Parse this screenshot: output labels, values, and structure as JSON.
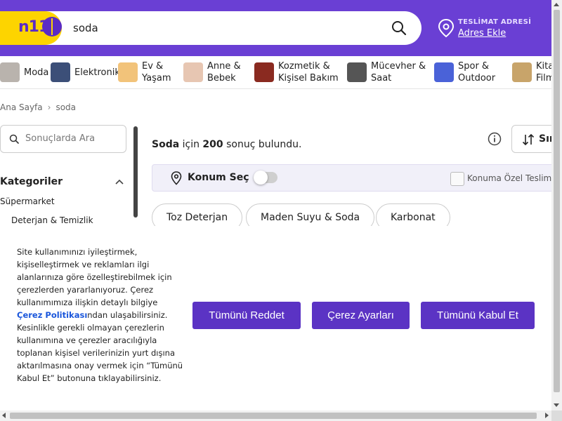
{
  "header": {
    "logo_text": "n11",
    "search_value": "soda",
    "address_label": "TESLİMAT ADRESİ",
    "address_link": "Adres Ekle"
  },
  "categories": [
    {
      "label": "Moda",
      "color": "#b9b3ad"
    },
    {
      "label": "Elektronik",
      "color": "#3c4f78"
    },
    {
      "label": "Ev &\nYaşam",
      "color": "#f2c37a"
    },
    {
      "label": "Anne &\nBebek",
      "color": "#e7c6b2"
    },
    {
      "label": "Kozmetik &\nKişisel Bakım",
      "color": "#8a2a20"
    },
    {
      "label": "Mücevher &\nSaat",
      "color": "#555555"
    },
    {
      "label": "Spor &\nOutdoor",
      "color": "#4a62d8"
    },
    {
      "label": "Kita\nFilm",
      "color": "#c8a46a"
    }
  ],
  "breadcrumb": {
    "home": "Ana Sayfa",
    "current": "soda"
  },
  "sidebar": {
    "search_placeholder": "Sonuçlarda Ara",
    "title": "Kategoriler",
    "item": "Süpermarket",
    "subitem": "Deterjan & Temizlik"
  },
  "results": {
    "query": "Soda",
    "pre": " için ",
    "count": "200",
    "post": " sonuç bulundu.",
    "sort_label": "Sır"
  },
  "location": {
    "label": "Konum Seç",
    "checkbox_label": "Konuma Özel Teslimat"
  },
  "chips": [
    "Toz Deterjan",
    "Maden Suyu & Soda",
    "Karbonat"
  ],
  "cookie": {
    "text_before": "Site kullanımınızı iyileştirmek, kişiselleştirmek ve reklamları ilgi alanlarınıza göre özelleştirebilmek için çerezlerden yararlanıyoruz. Çerez kullanımımıza ilişkin detaylı bilgiye ",
    "link": "Çerez Politikası",
    "text_after": "ndan ulaşabilirsiniz. Kesinlikle gerekli olmayan çerezlerin kullanımına ve çerezler aracılığıyla toplanan kişisel verilerinizin yurt dışına aktarılmasına onay vermek için “Tümünü Kabul Et” butonuna tıklayabilirsiniz.",
    "reject": "Tümünü Reddet",
    "settings": "Çerez Ayarları",
    "accept": "Tümünü Kabul Et"
  },
  "colors": {
    "brand_purple": "#6a3fd4",
    "logo_yellow": "#fdd400",
    "button_purple": "#5b33c4",
    "link_blue": "#1a56db"
  }
}
